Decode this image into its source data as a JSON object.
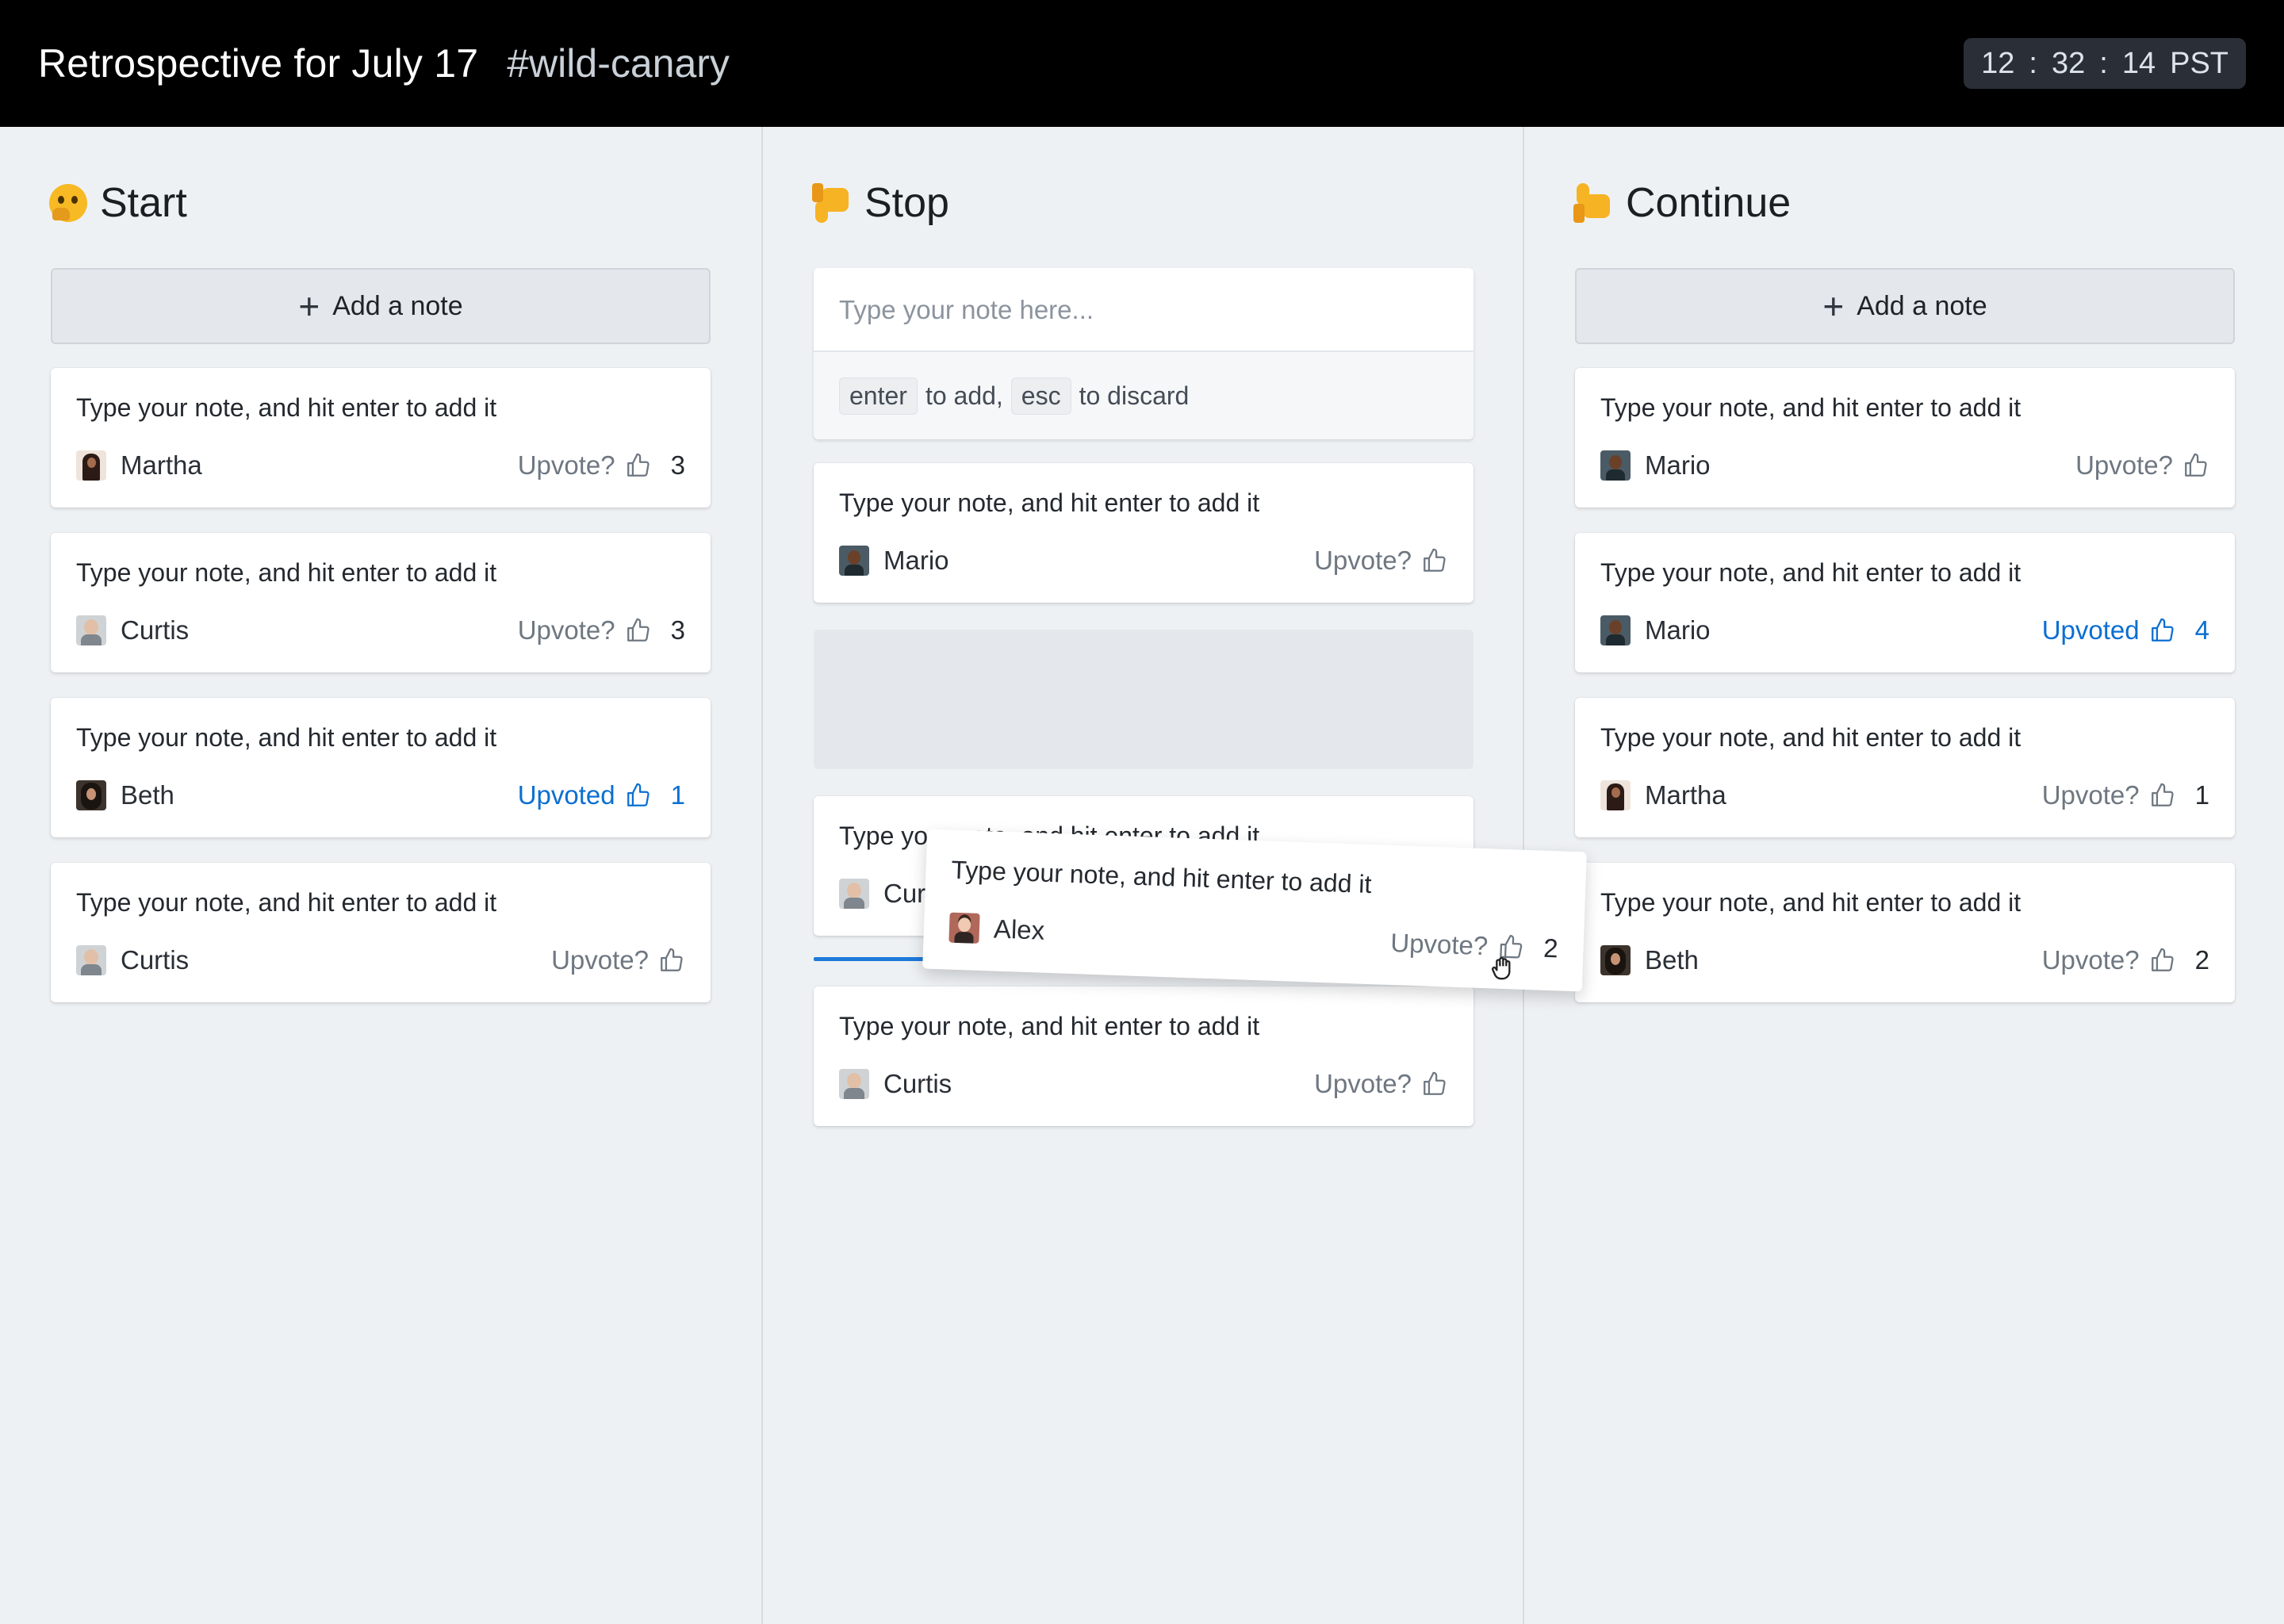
{
  "header": {
    "title": "Retrospective for July 17",
    "channel": "#wild-canary",
    "clock": {
      "hours": "12",
      "minutes": "32",
      "seconds": "14",
      "zone": "PST"
    }
  },
  "note_text": "Type your note, and hit enter to add it",
  "add_note_label": "Add a note",
  "upvote_label": "Upvote?",
  "upvoted_label": "Upvoted",
  "accent_color": "#0b6fd1",
  "columns": {
    "start": {
      "heading": "Start",
      "emoji": "thinking-face-icon",
      "cards": [
        {
          "text": "Type your note, and hit enter to add it",
          "author": "Martha",
          "vote_label": "Upvote?",
          "count": "3",
          "upvoted": false
        },
        {
          "text": "Type your note, and hit enter to add it",
          "author": "Curtis",
          "vote_label": "Upvote?",
          "count": "3",
          "upvoted": false
        },
        {
          "text": "Type your note, and hit enter to add it",
          "author": "Beth",
          "vote_label": "Upvoted",
          "count": "1",
          "upvoted": true
        },
        {
          "text": "Type your note, and hit enter to add it",
          "author": "Curtis",
          "vote_label": "Upvote?",
          "count": "",
          "upvoted": false
        }
      ]
    },
    "stop": {
      "heading": "Stop",
      "emoji": "thumbs-down-icon",
      "input": {
        "placeholder": "Type your note here...",
        "key_enter": "enter",
        "hint_add": "to add,",
        "key_esc": "esc",
        "hint_discard": "to discard"
      },
      "cards": [
        {
          "text": "Type your note, and hit enter to add it",
          "author": "Mario",
          "vote_label": "Upvote?",
          "count": "",
          "upvoted": false
        },
        {
          "text": "Type your note, and hit enter to add it",
          "author": "Curtis",
          "vote_label": "Upvote?",
          "count": "",
          "upvoted": false
        },
        {
          "text": "Type your note, and hit enter to add it",
          "author": "Curtis",
          "vote_label": "Upvote?",
          "count": "",
          "upvoted": false
        }
      ],
      "dragging_card": {
        "text": "Type your note, and hit enter to add it",
        "author": "Alex",
        "vote_label": "Upvote?",
        "count": "2"
      }
    },
    "continue": {
      "heading": "Continue",
      "emoji": "thumbs-up-icon",
      "cards": [
        {
          "text": "Type your note, and hit enter to add it",
          "author": "Mario",
          "vote_label": "Upvote?",
          "count": "",
          "upvoted": false
        },
        {
          "text": "Type your note, and hit enter to add it",
          "author": "Mario",
          "vote_label": "Upvoted",
          "count": "4",
          "upvoted": true
        },
        {
          "text": "Type your note, and hit enter to add it",
          "author": "Martha",
          "vote_label": "Upvote?",
          "count": "1",
          "upvoted": false
        },
        {
          "text": "Type your note, and hit enter to add it",
          "author": "Beth",
          "vote_label": "Upvote?",
          "count": "2",
          "upvoted": false
        }
      ]
    }
  }
}
